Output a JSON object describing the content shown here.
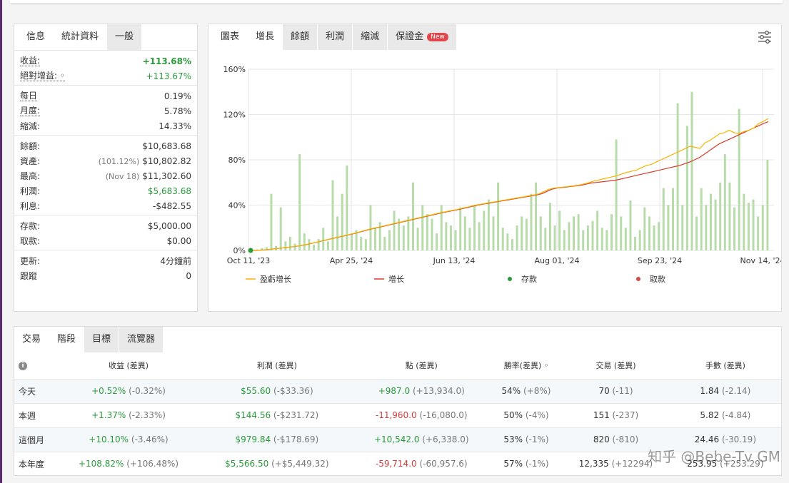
{
  "stats": {
    "tabs": [
      "信息",
      "統計資料",
      "一般"
    ],
    "groups": [
      [
        {
          "label": "收益:",
          "value": "+113.68%",
          "cls": "green bold",
          "dotted": true
        },
        {
          "label": "絕對增益: ◦",
          "value": "+113.67%",
          "cls": "green",
          "dotted": true
        }
      ],
      [
        {
          "label": "每日",
          "value": "0.19%",
          "dotted": true
        },
        {
          "label": "月度:",
          "value": "5.78%",
          "dotted": true
        },
        {
          "label": "縮減:",
          "value": "14.33%"
        }
      ],
      [
        {
          "label": "餘額:",
          "value": "$10,683.68"
        },
        {
          "label": "資產:",
          "prefix": "(101.12%)",
          "value": "$10,802.82"
        },
        {
          "label": "最高:",
          "prefix": "(Nov 18)",
          "value": "$11,302.60"
        },
        {
          "label": "利潤:",
          "value": "$5,683.68",
          "cls": "green"
        },
        {
          "label": "利息:",
          "value": "-$482.55"
        }
      ],
      [
        {
          "label": "存款:",
          "value": "$5,000.00"
        },
        {
          "label": "取款:",
          "value": "$0.00"
        }
      ],
      [
        {
          "label": "更新:",
          "value": "4分鐘前"
        },
        {
          "label": "跟蹤",
          "value": "0"
        }
      ]
    ]
  },
  "chart_tabs": {
    "t0": "圖表",
    "t1": "增長",
    "t2": "餘額",
    "t3": "利潤",
    "t4": "縮減",
    "t5": "保證金",
    "new_badge": "New"
  },
  "chart_data": {
    "type": "line",
    "x_ticks": [
      "Oct 11, '23",
      "Apr 25, '24",
      "Jun 13, '24",
      "Aug 01, '24",
      "Sep 23, '24",
      "Nov 14, '24"
    ],
    "y_ticks": [
      "0%",
      "40%",
      "80%",
      "120%",
      "160%"
    ],
    "ylim": [
      0,
      160
    ],
    "legend": [
      "盈虧增长",
      "增长",
      "存款",
      "取款"
    ],
    "colors": {
      "equity": "#f5b400",
      "growth": "#d83a2a",
      "deposit": "#2a9a3a",
      "withdraw": "#d14a4a",
      "bars": "#b7dba9"
    },
    "series": [
      {
        "name": "增长",
        "values": [
          0,
          0,
          0.3,
          0.6,
          1,
          1.5,
          2,
          2.5,
          3,
          3.6,
          4.2,
          5,
          6,
          7,
          8,
          9,
          10,
          11,
          12,
          13,
          14,
          15,
          16.2,
          17.4,
          18.5,
          19.5,
          20.5,
          21.5,
          22.5,
          23.5,
          24.5,
          25.5,
          26.5,
          27.5,
          28.5,
          29.5,
          30.5,
          31.5,
          32.5,
          33.5,
          34.3,
          35.2,
          36,
          37,
          38,
          39,
          40,
          40.8,
          41.5,
          42.3,
          43,
          43.8,
          44.5,
          45.3,
          46,
          46.8,
          47.5,
          48.3,
          49,
          50,
          52,
          54,
          55,
          55.5,
          56,
          56.5,
          57,
          57.5,
          58.5,
          59.5,
          60,
          60.5,
          61,
          61.5,
          62,
          63,
          64,
          65,
          66,
          67,
          68,
          69,
          70,
          71,
          72,
          73,
          74,
          75,
          76.5,
          78,
          80,
          82,
          85,
          88,
          91,
          94,
          96,
          98,
          100,
          102,
          104,
          106,
          108,
          110,
          112,
          113.7
        ]
      },
      {
        "name": "盈虧增长",
        "values": [
          0,
          0,
          0.3,
          0.6,
          1,
          1.5,
          2,
          2.5,
          3,
          3.6,
          4.2,
          5,
          6,
          7,
          8,
          9,
          10,
          11,
          12,
          13,
          14,
          15,
          16.2,
          17.4,
          18.5,
          19.5,
          20.5,
          21.5,
          22.5,
          23.5,
          24.5,
          25.5,
          26.5,
          27.5,
          28.5,
          29.5,
          30.5,
          31.5,
          32.5,
          33.5,
          34.3,
          35.2,
          36,
          37,
          38,
          39,
          40,
          40.8,
          41.5,
          42.3,
          43,
          43.8,
          44.5,
          45.3,
          46,
          46.8,
          47.5,
          48.3,
          49,
          50,
          52,
          54,
          55,
          55.5,
          56,
          56.5,
          57,
          57.5,
          58.5,
          59.5,
          61,
          62,
          63,
          64,
          65,
          66,
          67.5,
          69,
          70,
          71,
          73,
          75,
          76,
          78,
          80,
          82,
          84,
          86,
          88,
          90,
          92,
          91,
          90,
          95,
          97,
          100,
          103,
          104,
          106,
          104,
          103,
          105,
          106,
          108,
          112,
          114,
          116.5
        ]
      }
    ],
    "bars": [
      0,
      1,
      2,
      3,
      50,
      4,
      38,
      8,
      12,
      6,
      85,
      15,
      10,
      5,
      10,
      20,
      8,
      62,
      30,
      50,
      75,
      15,
      18,
      12,
      10,
      40,
      20,
      25,
      12,
      18,
      35,
      28,
      22,
      30,
      60,
      20,
      40,
      32,
      28,
      15,
      40,
      25,
      22,
      18,
      38,
      30,
      20,
      40,
      25,
      35,
      45,
      30,
      60,
      20,
      15,
      10,
      22,
      30,
      28,
      50,
      60,
      30,
      20,
      42,
      22,
      35,
      18,
      25,
      30,
      32,
      18,
      22,
      26,
      35,
      20,
      18,
      32,
      98,
      30,
      20,
      44,
      12,
      18,
      38,
      30,
      22,
      25,
      55,
      40,
      55,
      130,
      40,
      110,
      140,
      30,
      55,
      40,
      50,
      45,
      60,
      85,
      60,
      38,
      125,
      50,
      42,
      45,
      30,
      40,
      80
    ]
  },
  "periods": {
    "tabs": [
      "交易",
      "階段",
      "目標",
      "流覽器"
    ],
    "info_glyph": "i",
    "headers": [
      "收益 (差異)",
      "利潤 (差異)",
      "點 (差異)",
      "勝率(差異) ◦",
      "交易 (差異)",
      "手數 (差異)"
    ],
    "rows": [
      {
        "name": "今天",
        "growth": "+0.52%",
        "growth_diff": "(-0.32%)",
        "profit": "$55.60",
        "profit_diff": "(-$33.36)",
        "pips": "+987.0",
        "pips_diff": "(+13,934.0)",
        "pips_cls": "green",
        "win": "54%",
        "win_diff": "(+8%)",
        "trades": "70",
        "trades_diff": "(-11)",
        "lots": "1.84",
        "lots_diff": "(-2.14)"
      },
      {
        "name": "本週",
        "growth": "+1.37%",
        "growth_diff": "(-2.33%)",
        "profit": "$144.56",
        "profit_diff": "(-$231.72)",
        "pips": "-11,960.0",
        "pips_diff": "(-16,080.0)",
        "pips_cls": "red",
        "win": "50%",
        "win_diff": "(-4%)",
        "trades": "151",
        "trades_diff": "(-237)",
        "lots": "5.82",
        "lots_diff": "(-4.84)"
      },
      {
        "name": "這個月",
        "growth": "+10.10%",
        "growth_diff": "(-3.46%)",
        "profit": "$979.84",
        "profit_diff": "(-$178.69)",
        "pips": "+10,542.0",
        "pips_diff": "(+6,338.0)",
        "pips_cls": "green",
        "win": "53%",
        "win_diff": "(-1%)",
        "trades": "820",
        "trades_diff": "(-810)",
        "lots": "24.46",
        "lots_diff": "(-30.19)"
      },
      {
        "name": "本年度",
        "growth": "+108.82%",
        "growth_diff": "(+106.48%)",
        "profit": "$5,566.50",
        "profit_diff": "(+$5,449.32)",
        "pips": "-59,714.0",
        "pips_diff": "(-60,957.6)",
        "pips_cls": "red",
        "win": "57%",
        "win_diff": "(-1%)",
        "trades": "12,335",
        "trades_diff": "(+12294)",
        "lots": "253.95",
        "lots_diff": "(+253.29)"
      }
    ]
  },
  "watermark": "知乎 @Bebe-Tv GM"
}
